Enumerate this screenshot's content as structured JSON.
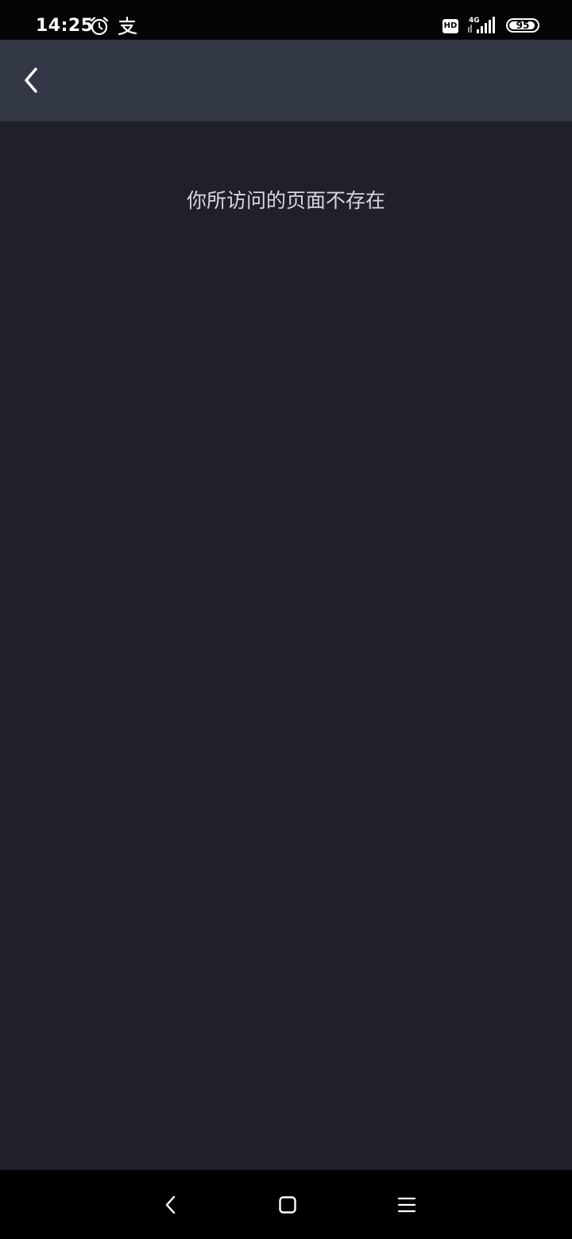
{
  "status_bar": {
    "time": "14:25",
    "network_badge": "HD",
    "network_type": "4G",
    "battery_level": "95",
    "icons": [
      "alarm-icon",
      "alipay-icon",
      "signal-icon",
      "battery-icon"
    ]
  },
  "header": {
    "back_icon": "chevron-left-icon"
  },
  "main": {
    "message": "你所访问的页面不存在"
  },
  "nav_bar": {
    "icons": [
      "nav-back-icon",
      "nav-home-icon",
      "nav-recents-icon"
    ]
  },
  "colors": {
    "status_bar_bg": "#050507",
    "header_bg": "#333847",
    "content_bg": "#202029",
    "message_text": "#d7d7dc",
    "nav_bar_bg": "#000000"
  }
}
